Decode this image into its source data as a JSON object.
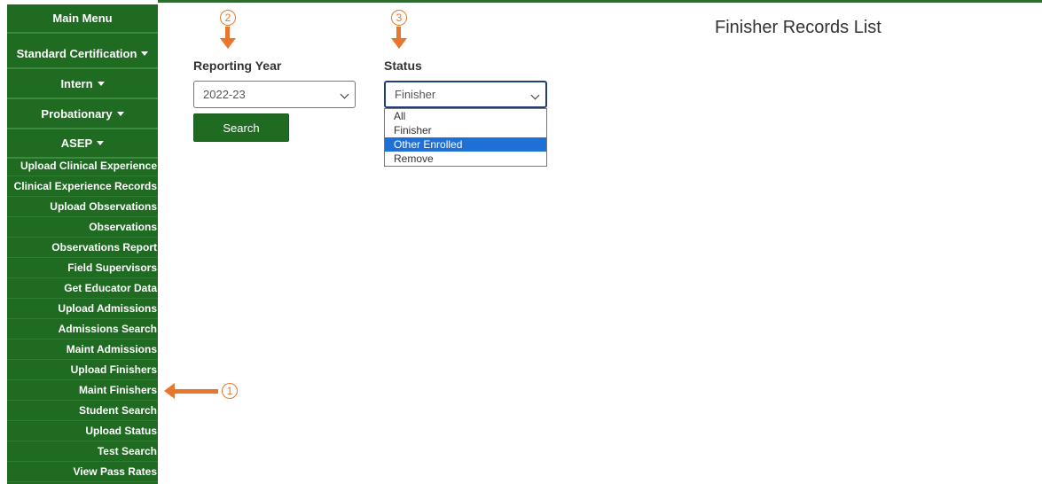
{
  "page": {
    "title": "Finisher Records List"
  },
  "sidebar": {
    "main_menu": "Main Menu",
    "standard_certification": "Standard Certification",
    "intern": "Intern",
    "probationary": "Probationary",
    "asep": "ASEP",
    "asep_items": [
      "Upload Clinical Experience",
      "Clinical Experience Records",
      "Upload Observations",
      "Observations",
      "Observations Report",
      "Field Supervisors",
      "Get Educator Data",
      "Upload Admissions",
      "Admissions Search",
      "Maint Admissions",
      "Upload Finishers",
      "Maint Finishers",
      "Student Search",
      "Upload Status",
      "Test Search",
      "View Pass Rates"
    ]
  },
  "form": {
    "reporting_year": {
      "label": "Reporting Year",
      "value": "2022-23"
    },
    "status": {
      "label": "Status",
      "value": "Finisher",
      "options": [
        "All",
        "Finisher",
        "Other Enrolled",
        "Remove"
      ],
      "highlighted": "Other Enrolled"
    },
    "search_label": "Search"
  },
  "callouts": {
    "one": "1",
    "two": "2",
    "three": "3",
    "color": "#e8762c"
  },
  "colors": {
    "sidebar": "#1f6b22",
    "highlight": "#1e6fd6"
  }
}
